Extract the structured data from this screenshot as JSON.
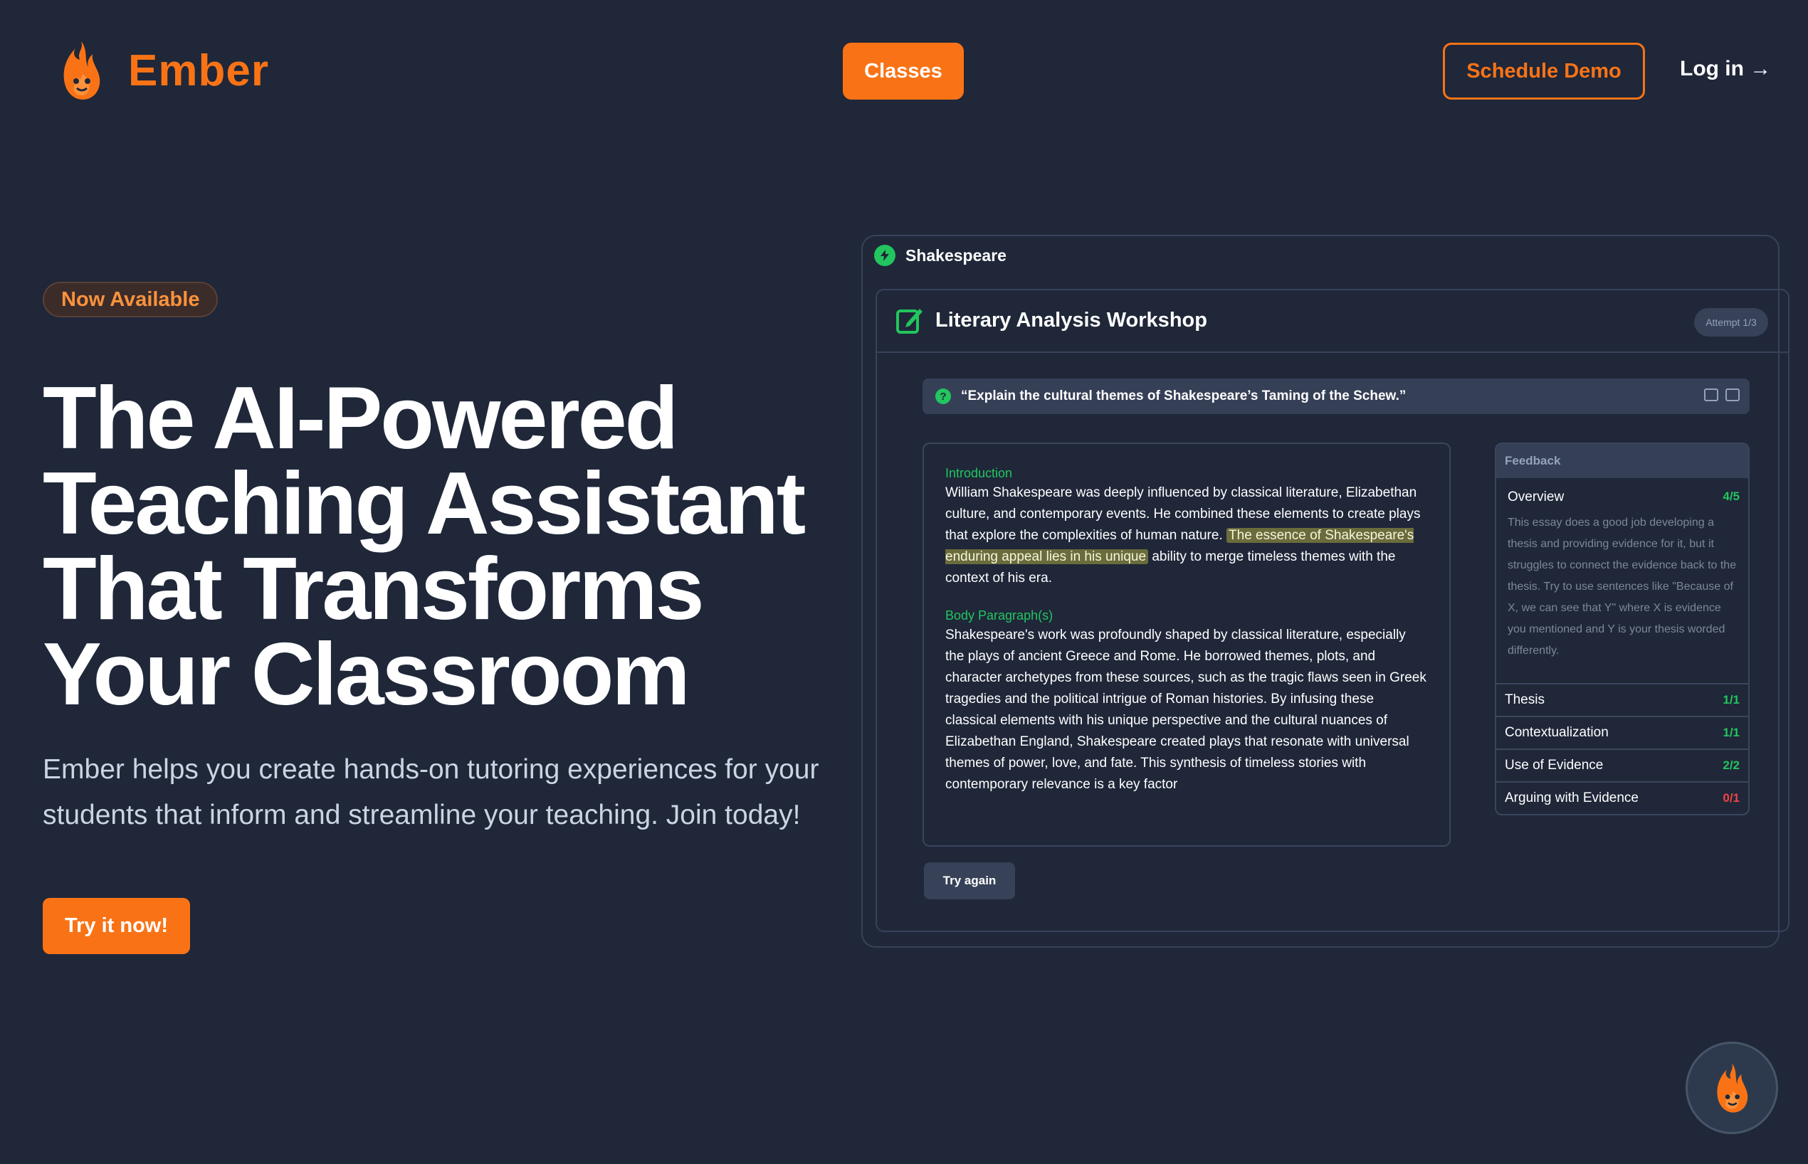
{
  "header": {
    "brand": "Ember",
    "nav_classes": "Classes",
    "schedule_demo": "Schedule Demo",
    "login": "Log in →"
  },
  "hero": {
    "badge": "Now Available",
    "headline": "The AI-Powered Teaching Assistant That Transforms Your Classroom",
    "subcopy": "Ember helps you create hands-on tutoring experiences for your students that inform and streamline your teaching. Join today!",
    "cta": "Try it now!"
  },
  "demo": {
    "class_name": "Shakespeare",
    "workshop_title": "Literary Analysis Workshop",
    "attempt": "Attempt 1/3",
    "question": "“Explain the cultural themes of Shakespeare’s Taming of the Schew.”",
    "essay": {
      "intro_label": "Introduction",
      "intro_before": "William Shakespeare was deeply influenced by classical literature, Elizabethan culture, and contemporary events. He combined these elements to create plays that explore the complexities of human nature.",
      "intro_highlight": "The essence of Shakespeare's enduring appeal lies in his unique",
      "intro_after": "ability to merge timeless themes with the context of his era.",
      "body_label": "Body Paragraph(s)",
      "body_text": "Shakespeare's work was profoundly shaped by classical literature, especially the plays of ancient Greece and Rome. He borrowed themes, plots, and character archetypes from these sources, such as the tragic flaws seen in Greek tragedies and the political intrigue of Roman histories. By infusing these classical elements with his unique perspective and the cultural nuances of Elizabethan England, Shakespeare created plays that resonate with universal themes of power, love, and fate. This synthesis of timeless stories with contemporary relevance is a key factor"
    },
    "feedback": {
      "title": "Feedback",
      "overview_label": "Overview",
      "overview_score": "4/5",
      "overview_text": "This essay does a good job developing a thesis and providing evidence for it, but it struggles to connect the evidence back to the thesis. Try to use sentences like \"Because of X, we can see that Y\" where X is evidence you mentioned and Y is your thesis worded differently.",
      "criteria": [
        {
          "label": "Thesis",
          "score": "1/1"
        },
        {
          "label": "Contextualization",
          "score": "1/1"
        },
        {
          "label": "Use of Evidence",
          "score": "2/2"
        },
        {
          "label": "Arguing with Evidence",
          "score": "0/1"
        }
      ]
    },
    "try_again": "Try again"
  },
  "colors": {
    "accent": "#f97316",
    "background": "#1f2739",
    "success": "#22c55e",
    "danger": "#ef4444"
  },
  "icons": {
    "brand_logo": "flame-mascot-icon",
    "class_badge": "bolt-icon",
    "workshop": "edit-icon",
    "question": "question-icon",
    "chat": "flame-mascot-icon"
  }
}
